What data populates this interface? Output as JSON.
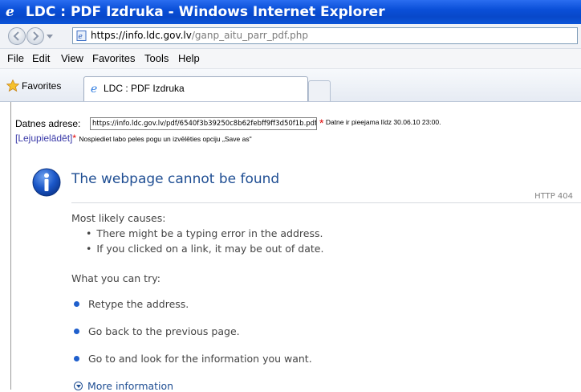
{
  "window": {
    "title": "LDC : PDF Izdruka - Windows Internet Explorer"
  },
  "addressbar": {
    "url_host": "https://info.ldc.gov.lv",
    "url_path": "/ganp_aitu_parr_pdf.php"
  },
  "menu": [
    "File",
    "Edit",
    "View",
    "Favorites",
    "Tools",
    "Help"
  ],
  "favorites": {
    "label": "Favorites",
    "tab_title": "LDC : PDF Izdruka"
  },
  "page": {
    "address_label": "Datnes adrese:",
    "file_url": "https://info.ldc.gov.lv/pdf/6540f3b39250c8b62febff9ff3d50f1b.pdf",
    "availability_star": "*",
    "availability_text": "Datne ir pieejama līdz 30.06.10 23:00.",
    "download_link": "[Lejupielādēt]",
    "download_star": "*",
    "download_hint": "Nospiediet labo peles pogu un izvēlēties opciju „Save as\""
  },
  "error": {
    "title": "The webpage cannot be found",
    "code": "HTTP 404",
    "causes_heading": "Most likely causes:",
    "causes": [
      "There might be a typing error in the address.",
      "If you clicked on a link, it may be out of date."
    ],
    "try_heading": "What you can try:",
    "tries": [
      "Retype the address.",
      "Go back to the previous page.",
      "Go to  and look for the information you want."
    ],
    "more_info": "More information"
  }
}
